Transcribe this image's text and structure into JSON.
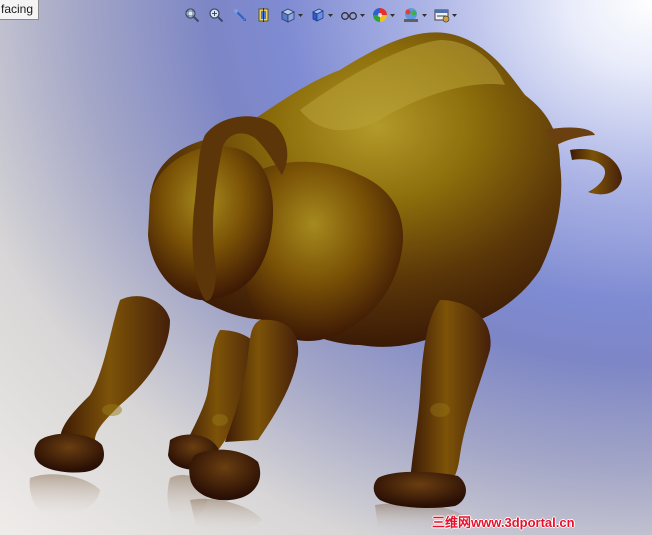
{
  "view": {
    "orientation_label": "facing",
    "background": {
      "top_right": "#ffffff",
      "mid": "#7f8bd2",
      "bottom": "#efecea"
    }
  },
  "toolbar": {
    "items": [
      {
        "name": "zoom-to-fit-icon"
      },
      {
        "name": "zoom-to-area-icon"
      },
      {
        "name": "previous-view-icon"
      },
      {
        "name": "section-view-icon"
      },
      {
        "name": "view-orientation-icon",
        "has_menu": true
      },
      {
        "name": "display-style-icon",
        "has_menu": true
      },
      {
        "name": "hide-show-items-icon",
        "has_menu": true
      },
      {
        "name": "edit-appearance-icon",
        "has_menu": true
      },
      {
        "name": "apply-scene-icon",
        "has_menu": true
      },
      {
        "name": "view-settings-icon",
        "has_menu": true
      }
    ]
  },
  "model": {
    "name": "bull-sculpture",
    "color": "#8a6a0c"
  },
  "watermark": {
    "text": "三维网www.3dportal.cn",
    "color": "#e8102a"
  }
}
